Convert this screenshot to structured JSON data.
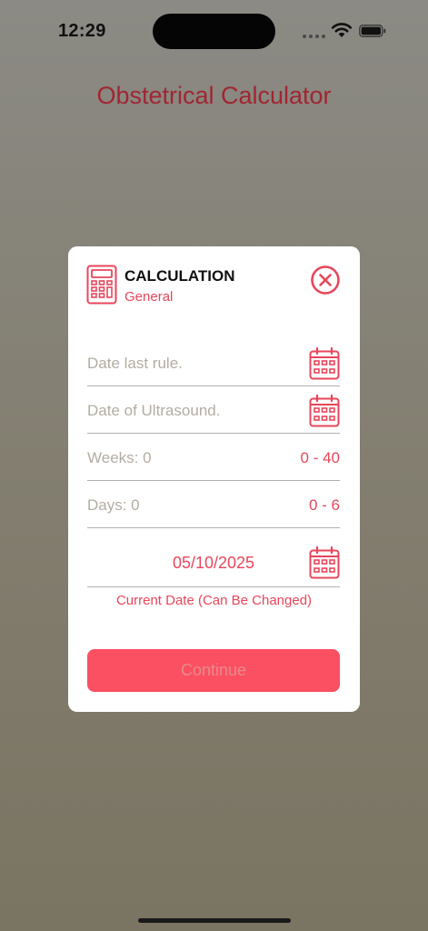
{
  "status_bar": {
    "time": "12:29"
  },
  "app": {
    "title": "Obstetrical Calculator"
  },
  "modal": {
    "title": "CALCULATION",
    "subtitle": "General",
    "fields": {
      "last_rule": {
        "placeholder": "Date last rule."
      },
      "ultrasound": {
        "placeholder": "Date of Ultrasound."
      },
      "weeks": {
        "label": "Weeks: 0",
        "range": "0 - 40"
      },
      "days": {
        "label": "Days: 0",
        "range": "0 - 6"
      }
    },
    "current_date": {
      "value": "05/10/2025",
      "note": "Current Date (Can Be Changed)"
    },
    "continue_label": "Continue"
  },
  "colors": {
    "accent": "#e8465b",
    "title": "#a02632",
    "button": "#fb4f62",
    "button_text_disabled": "#e88a8a",
    "placeholder": "#b3aca2"
  },
  "icons": {
    "header": "calculator-icon",
    "close": "close-circle-icon",
    "calendar": "calendar-icon"
  }
}
